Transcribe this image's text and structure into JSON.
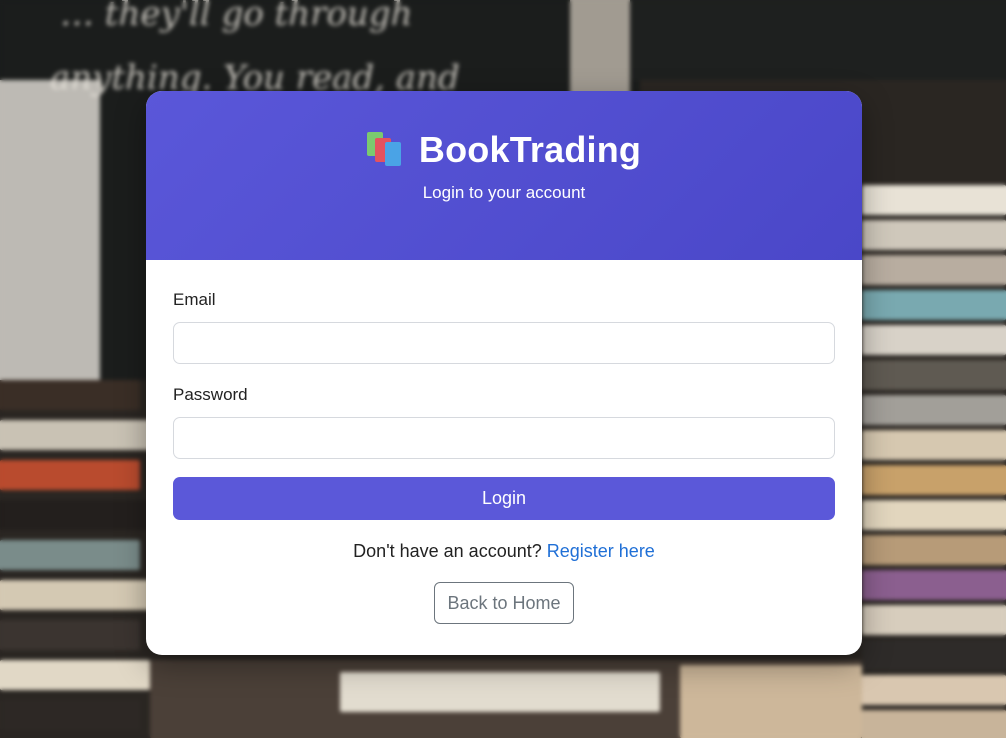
{
  "app": {
    "title": "BookTrading",
    "subtitle": "Login to your account"
  },
  "form": {
    "email_label": "Email",
    "email_value": "",
    "password_label": "Password",
    "password_value": "",
    "login_label": "Login"
  },
  "footer": {
    "register_prompt": "Don't have an account?",
    "register_link": "Register here",
    "back_label": "Back to Home"
  },
  "colors": {
    "accent": "#5b58d9",
    "link": "#1f6fd6",
    "secondary": "#6c757d"
  },
  "icons": {
    "brand": "books-icon"
  }
}
